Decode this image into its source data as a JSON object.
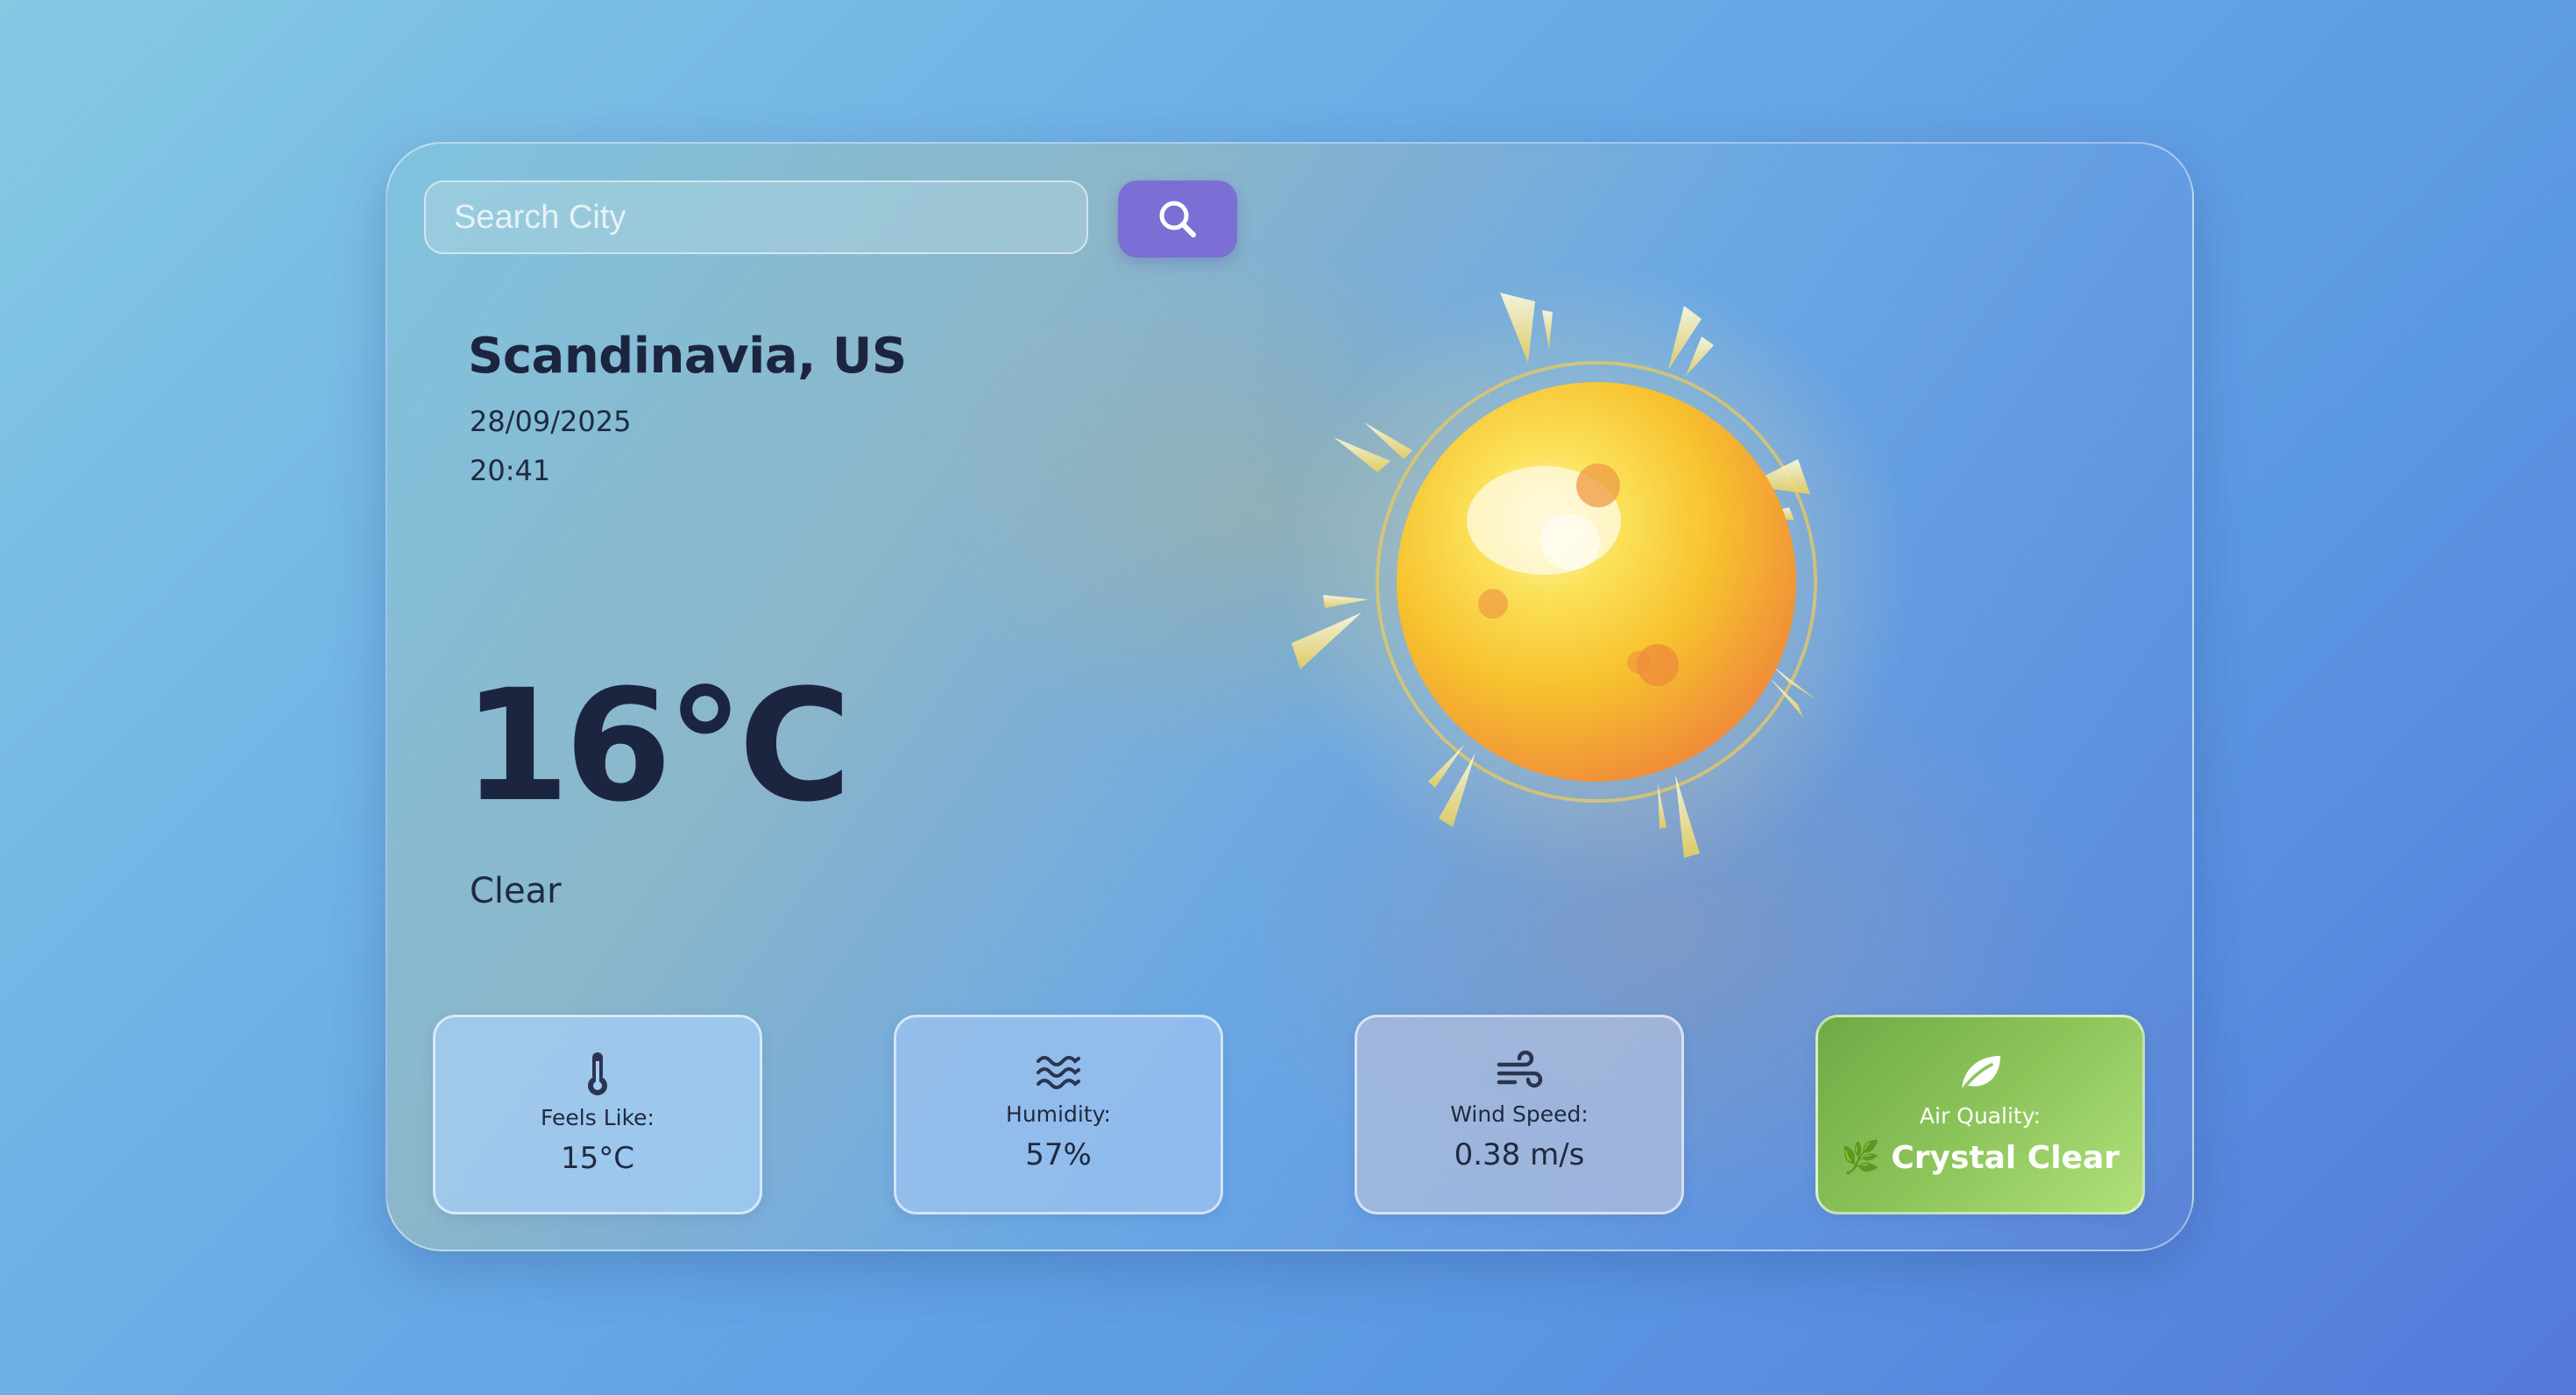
{
  "search": {
    "placeholder": "Search City",
    "button_icon": "search-icon"
  },
  "weather": {
    "location": "Scandinavia, US",
    "date": "28/09/2025",
    "time": "20:41",
    "temperature": "16°C",
    "condition": "Clear",
    "illustration": "sun-icon"
  },
  "stats": {
    "feels_like": {
      "icon": "thermometer-icon",
      "label": "Feels Like:",
      "value": "15°C"
    },
    "humidity": {
      "icon": "humidity-waves-icon",
      "label": "Humidity:",
      "value": "57%"
    },
    "wind": {
      "icon": "wind-icon",
      "label": "Wind Speed:",
      "value": "0.38 m/s"
    },
    "air_quality": {
      "icon": "leaf-icon",
      "label": "Air Quality:",
      "value": "🌿 Crystal Clear"
    }
  },
  "colors": {
    "accent": "#7b6fd6",
    "text_dark": "#1c2540",
    "air_good": "#8cc45a"
  }
}
